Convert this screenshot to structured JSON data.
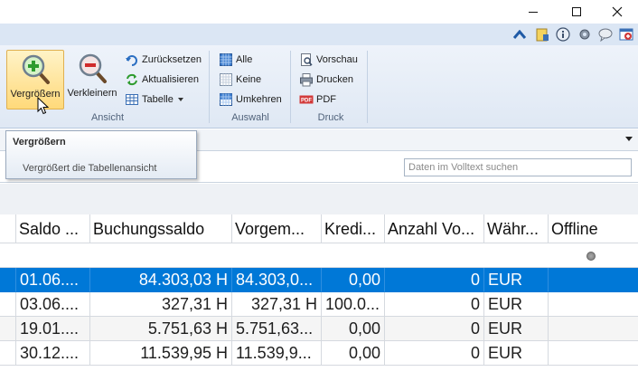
{
  "ribbon": {
    "groups": {
      "ansicht": "Ansicht",
      "auswahl": "Auswahl",
      "druck": "Druck"
    },
    "buttons": {
      "vergroessern": "Vergrößern",
      "verkleinern": "Verkleinern",
      "zuruecksetzen": "Zurücksetzen",
      "aktualisieren": "Aktualisieren",
      "tabelle": "Tabelle",
      "alle": "Alle",
      "keine": "Keine",
      "umkehren": "Umkehren",
      "vorschau": "Vorschau",
      "drucken": "Drucken",
      "pdf": "PDF"
    }
  },
  "tooltip": {
    "title": "Vergrößern",
    "description": "Vergrößert die Tabellenansicht"
  },
  "search": {
    "placeholder": "Daten im Volltext suchen"
  },
  "table": {
    "columns": [
      "Saldo ...",
      "Buchungssaldo",
      "Vorgem...",
      "Kredi...",
      "Anzahl Vo...",
      "Währ...",
      "Offline"
    ],
    "rows": [
      [
        "01.06....",
        "84.303,03 H",
        "84.303,0...",
        "0,00",
        "0",
        "EUR",
        ""
      ],
      [
        "03.06....",
        "327,31 H",
        "327,31 H",
        "100.0...",
        "0",
        "EUR",
        ""
      ],
      [
        "19.01....",
        "5.751,63 H",
        "5.751,63...",
        "0,00",
        "0",
        "EUR",
        ""
      ],
      [
        "30.12....",
        "11.539,95 H",
        "11.539,9...",
        "0,00",
        "0",
        "EUR",
        ""
      ]
    ],
    "selected_row": 0
  },
  "colors": {
    "selection": "#0078d7",
    "ribbon_bg": "#dfe8f4",
    "hover_button": "#ffd97a"
  },
  "icons": {
    "zoom_in": "magnifier-plus-icon",
    "zoom_out": "magnifier-minus-icon"
  }
}
